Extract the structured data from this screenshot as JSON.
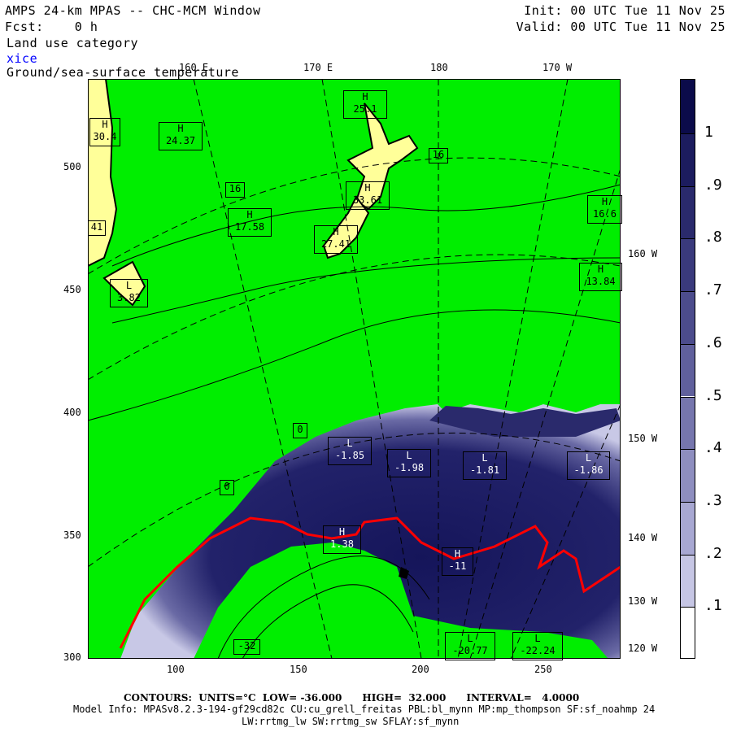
{
  "header": {
    "title": "AMPS 24-km MPAS -- CHC-MCM Window",
    "fcst": "Fcst:    0 h",
    "init": "Init: 00 UTC Tue 11 Nov 25",
    "valid": "Valid: 00 UTC Tue 11 Nov 25",
    "field1": "Land use category",
    "field2": "xice",
    "field3": "Ground/sea-surface temperature"
  },
  "axes": {
    "top": [
      "160 E",
      "170 E",
      "180",
      "170 W"
    ],
    "right": [
      "160 W",
      "150 W",
      "140 W",
      "130 W",
      "120 W"
    ],
    "y": [
      "500",
      "450",
      "400",
      "350",
      "300"
    ],
    "x": [
      "100",
      "150",
      "200",
      "250"
    ]
  },
  "labels": [
    {
      "k": "H",
      "v": "24.37"
    },
    {
      "k": "H",
      "v": "30.4"
    },
    {
      "k": "",
      "v": "16"
    },
    {
      "k": "H",
      "v": "17.58"
    },
    {
      "k": "H",
      "v": "25.1"
    },
    {
      "k": "H",
      "v": "33.61"
    },
    {
      "k": "H",
      "v": "27.41"
    },
    {
      "k": "",
      "v": "16"
    },
    {
      "k": "H",
      "v": "16.6"
    },
    {
      "k": "H",
      "v": "13.84"
    },
    {
      "k": "L",
      "v": "3.82"
    },
    {
      "k": "",
      "v": "41"
    },
    {
      "k": "",
      "v": "0"
    },
    {
      "k": "",
      "v": "0"
    },
    {
      "k": "L",
      "v": "-1.85"
    },
    {
      "k": "L",
      "v": "-1.98"
    },
    {
      "k": "L",
      "v": "-1.81"
    },
    {
      "k": "L",
      "v": "-1.86"
    },
    {
      "k": "H",
      "v": "1.38"
    },
    {
      "k": "H",
      "v": "-11"
    },
    {
      "k": "L",
      "v": "-20.77"
    },
    {
      "k": "L",
      "v": "-22.24"
    },
    {
      "k": "",
      "v": "-32"
    }
  ],
  "colorbar": {
    "labels": [
      "1",
      ".9",
      ".8",
      ".7",
      ".6",
      ".5",
      ".4",
      ".3",
      ".2",
      ".1"
    ],
    "colors": [
      "#0b0b4a",
      "#1c1c5e",
      "#2a2a6c",
      "#3a3a7c",
      "#4c4c8c",
      "#60609c",
      "#7676ad",
      "#8e8ebf",
      "#a8a8d2",
      "#c6c6e4",
      "#ffffff"
    ]
  },
  "footer": {
    "contours": "CONTOURS:  UNITS=°C  LOW= -36.000      HIGH=  32.000      INTERVAL=   4.0000",
    "model": "Model Info: MPASv8.2.3-194-gf29cd82c CU:cu_grell_freitas PBL:bl_mynn MP:mp_thompson SF:sf_noahmp 24",
    "model2": "LW:rrtmg_lw SW:rrtmg_sw SFLAY:sf_mynn"
  },
  "colors": {
    "land_green": "#00ee00",
    "land_yellow": "#ffff99",
    "ice_dark": "#14145a",
    "contour_red": "#ff0000"
  }
}
